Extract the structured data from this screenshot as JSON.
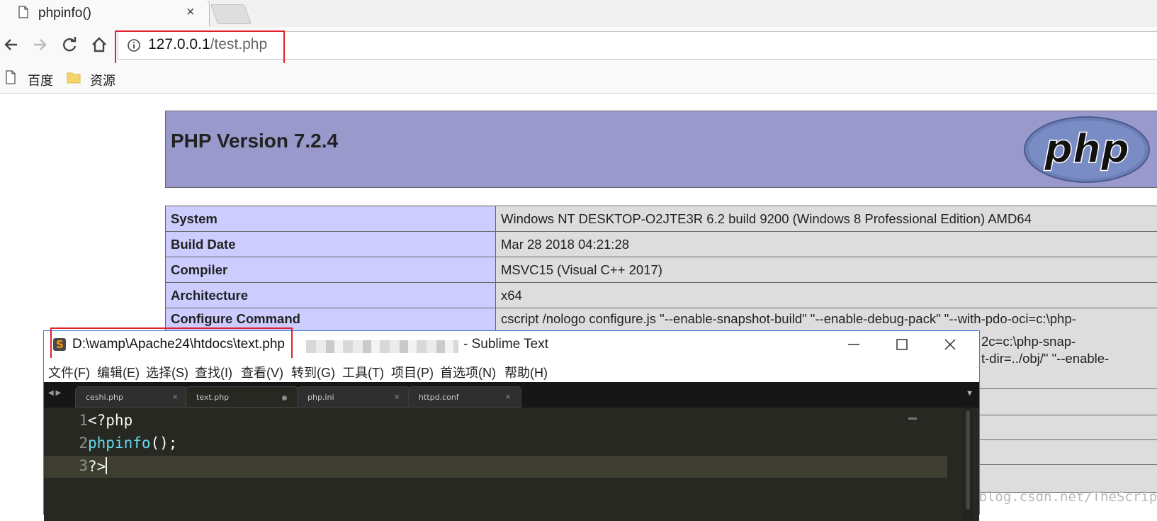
{
  "browser": {
    "tab_title": "phpinfo()",
    "tab_close": "×",
    "url_host": "127.0.0.1",
    "url_path": "/test.php",
    "bookmarks": [
      {
        "label": "百度"
      },
      {
        "label": "资源"
      }
    ]
  },
  "phpinfo": {
    "version_title": "PHP Version 7.2.4",
    "logo_text": "php",
    "rows": [
      {
        "key": "System",
        "value": "Windows NT DESKTOP-O2JTE3R 6.2 build 9200 (Windows 8 Professional Edition) AMD64"
      },
      {
        "key": "Build Date",
        "value": "Mar 28 2018 04:21:28"
      },
      {
        "key": "Compiler",
        "value": "MSVC15 (Visual C++ 2017)"
      },
      {
        "key": "Architecture",
        "value": "x64"
      },
      {
        "key": "Configure Command",
        "value": "cscript /nologo configure.js \"--enable-snapshot-build\" \"--enable-debug-pack\" \"--with-pdo-oci=c:\\php-"
      }
    ],
    "configure_cont": [
      "2c=c:\\php-snap-",
      "t-dir=../obj/\" \"--enable-"
    ]
  },
  "sublime": {
    "file_path": "D:\\wamp\\Apache24\\htdocs\\text.php",
    "app_name": "- Sublime Text",
    "menu": [
      "文件(F)",
      "编辑(E)",
      "选择(S)",
      "查找(I)",
      "查看(V)",
      "转到(G)",
      "工具(T)",
      "项目(P)",
      "首选项(N)",
      "帮助(H)"
    ],
    "tabs": [
      {
        "label": "ceshi.php",
        "active": false,
        "dirty": false
      },
      {
        "label": "text.php",
        "active": true,
        "dirty": true
      },
      {
        "label": "php.ini",
        "active": false,
        "dirty": false
      },
      {
        "label": "httpd.conf",
        "active": false,
        "dirty": false
      }
    ],
    "lines": [
      {
        "num": "1",
        "code": "<?php"
      },
      {
        "num": "2",
        "fn": "phpinfo",
        "rest": "();"
      },
      {
        "num": "3",
        "code": "?>"
      }
    ]
  },
  "watermark": "https://blog.csdn.net/TheScript_j",
  "colors": {
    "highlight_box": "#e0202a",
    "php_header": "#9999cc",
    "php_key": "#ccccff",
    "php_value": "#dddddd",
    "editor_bg": "#272822",
    "keyword": "#66d9ef"
  }
}
